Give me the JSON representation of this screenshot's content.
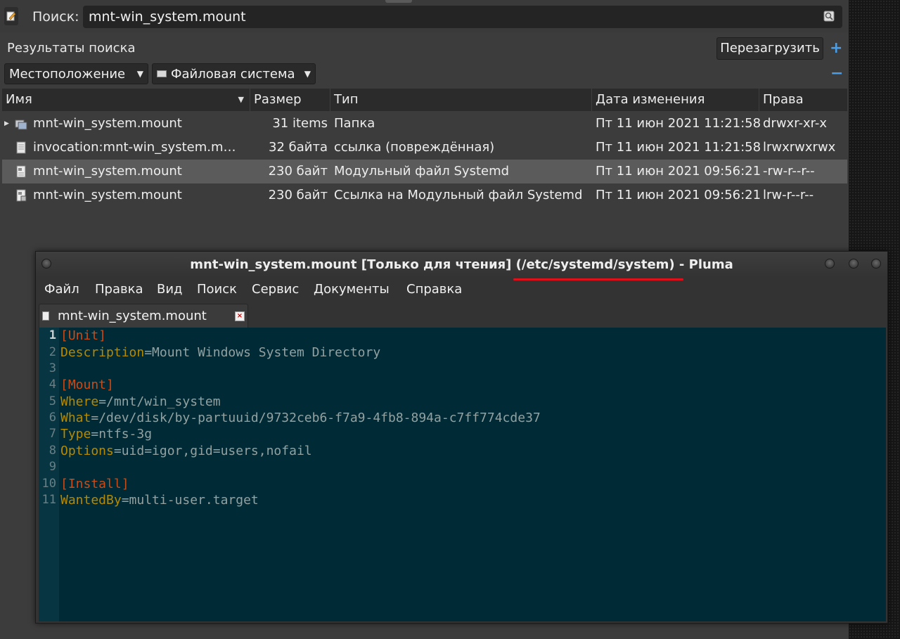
{
  "search_window": {
    "search_label": "Поиск:",
    "search_value": "mnt-win_system.mount",
    "results_label": "Результаты поиска",
    "reload_label": "Перезагрузить",
    "add_label": "+",
    "remove_label": "−",
    "filters": [
      {
        "label": "Местоположение"
      },
      {
        "label": "Файловая система"
      }
    ],
    "columns": [
      "Имя",
      "Размер",
      "Тип",
      "Дата изменения",
      "Права"
    ],
    "rows": [
      {
        "name": "mnt-win_system.mount",
        "size": "31 items",
        "type": "Папка",
        "date": "Пт 11 июн 2021 11:21:58",
        "perm": "drwxr-xr-x"
      },
      {
        "name": "invocation:mnt-win_system.m…",
        "size": "32 байта",
        "type": "ссылка (повреждённая)",
        "date": "Пт 11 июн 2021 11:21:58",
        "perm": "lrwxrwxrwx"
      },
      {
        "name": "mnt-win_system.mount",
        "size": "230 байт",
        "type": "Модульный файл Systemd",
        "date": "Пт 11 июн 2021 09:56:21",
        "perm": "-rw-r--r--"
      },
      {
        "name": "mnt-win_system.mount",
        "size": "230 байт",
        "type": "Ссылка на Модульный файл Systemd",
        "date": "Пт 11 июн 2021 09:56:21",
        "perm": "lrw-r--r--"
      }
    ],
    "selected_row": 3
  },
  "editor_window": {
    "title": "mnt-win_system.mount [Только для чтения] (/etc/systemd/system) - Pluma",
    "menu": [
      "Файл",
      "Правка",
      "Вид",
      "Поиск",
      "Сервис",
      "Документы",
      "Справка"
    ],
    "tab_label": "mnt-win_system.mount",
    "lines": [
      {
        "n": "1",
        "section": "[Unit]"
      },
      {
        "n": "2",
        "key": "Description",
        "value": "=Mount Windows System Directory"
      },
      {
        "n": "3"
      },
      {
        "n": "4",
        "section": "[Mount]"
      },
      {
        "n": "5",
        "key": "Where",
        "value": "=/mnt/win_system"
      },
      {
        "n": "6",
        "key": "What",
        "value": "=/dev/disk/by-partuuid/9732ceb6-f7a9-4fb8-894a-c7ff774cde37"
      },
      {
        "n": "7",
        "key": "Type",
        "value": "=ntfs-3g"
      },
      {
        "n": "8",
        "key": "Options",
        "value": "=uid=igor,gid=users,nofail"
      },
      {
        "n": "9"
      },
      {
        "n": "10",
        "section": "[Install]"
      },
      {
        "n": "11",
        "key": "WantedBy",
        "value": "=multi-user.target"
      }
    ],
    "current_line": 1
  },
  "colors": {
    "editor_bg": "#002b36",
    "section": "#cb4b16",
    "key": "#b58900",
    "text": "#93a1a1",
    "highlight_underline": "#e0101a",
    "accent": "#4a9ee8"
  }
}
